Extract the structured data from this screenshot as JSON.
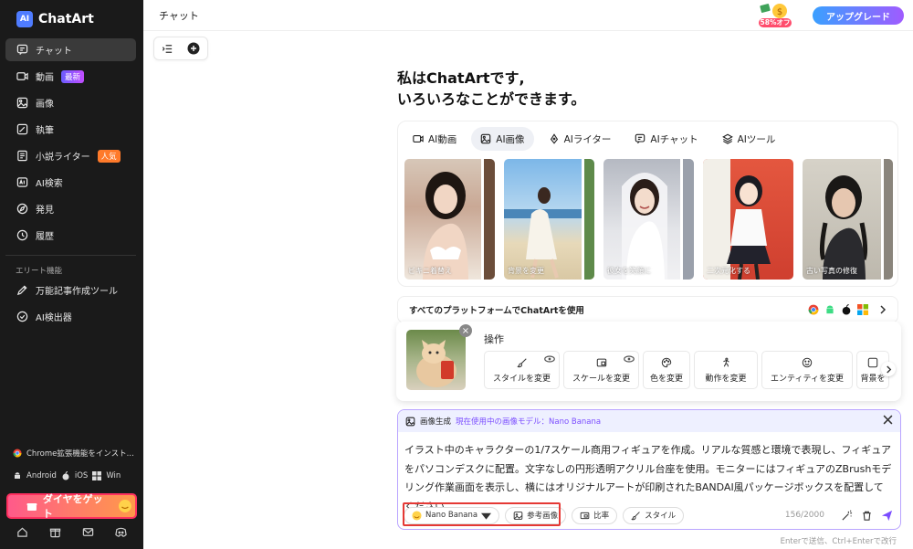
{
  "app": {
    "name": "ChatArt",
    "logo_mark": "AI"
  },
  "sidebar": {
    "items": [
      {
        "label": "チャット",
        "icon": "chat-icon",
        "active": true
      },
      {
        "label": "動画",
        "icon": "video-icon",
        "badge": "最新"
      },
      {
        "label": "画像",
        "icon": "image-icon"
      },
      {
        "label": "執筆",
        "icon": "pen-icon"
      },
      {
        "label": "小説ライター",
        "icon": "book-icon",
        "badge": "人気"
      },
      {
        "label": "AI検索",
        "icon": "ai-search-icon"
      },
      {
        "label": "発見",
        "icon": "compass-icon"
      },
      {
        "label": "履歴",
        "icon": "history-icon"
      }
    ],
    "section_label": "エリート機能",
    "elite_items": [
      {
        "label": "万能記事作成ツール",
        "icon": "edit-icon"
      },
      {
        "label": "AI検出器",
        "icon": "check-circle-icon"
      }
    ],
    "chrome_ext": "Chrome拡張機能をインスト...",
    "platforms": [
      "Android",
      "iOS",
      "Win"
    ],
    "diamond_button": "ダイヤをゲット"
  },
  "header": {
    "title": "チャット",
    "sale_badge": "58%オフ",
    "upgrade_label": "アップグレード"
  },
  "greeting": {
    "line1": "私はChatArtです,",
    "line2": "いろいろなことができます。"
  },
  "feature_tabs": [
    {
      "label": "AI動画",
      "icon": "video-icon"
    },
    {
      "label": "AI画像",
      "icon": "image-icon",
      "active": true
    },
    {
      "label": "AIライター",
      "icon": "pen-nib-icon"
    },
    {
      "label": "AIチャット",
      "icon": "chat-icon"
    },
    {
      "label": "AIツール",
      "icon": "layers-icon"
    }
  ],
  "thumbnails": [
    {
      "label": "ビキニ着替え"
    },
    {
      "label": "背景を変更"
    },
    {
      "label": "彼女を笑顔に"
    },
    {
      "label": "二次元化する"
    },
    {
      "label": "古い写真の修復"
    }
  ],
  "platform_bar": {
    "text": "すべてのプラットフォームでChatArtを使用"
  },
  "operations": {
    "title": "操作",
    "buttons": [
      {
        "label": "スタイルを変更",
        "icon": "brush-icon"
      },
      {
        "label": "スケールを変更",
        "icon": "scale-icon"
      },
      {
        "label": "色を変更",
        "icon": "palette-icon"
      },
      {
        "label": "動作を変更",
        "icon": "motion-icon"
      },
      {
        "label": "エンティティを変更",
        "icon": "smile-icon"
      },
      {
        "label": "背景を",
        "icon": "background-icon"
      }
    ]
  },
  "input_panel": {
    "mode_label": "画像生成",
    "model_label": "現在使用中の画像モデル：Nano Banana",
    "prompt": "イラスト中のキャラクターの1/7スケール商用フィギュアを作成。リアルな質感と環境で表現し、フィギュアをパソコンデスクに配置。文字なしの円形透明アクリル台座を使用。モニターにはフィギュアのZBrushモデリング作業画面を表示し、横にはオリジナルアートが印刷されたBANDAI風パッケージボックスを配置してください。",
    "model_pill": "Nano Banana",
    "reference_pill": "参考画像",
    "ratio_pill": "比率",
    "style_pill": "スタイル",
    "counter": "156/2000"
  },
  "hint": "Enterで送信、Ctrl+Enterで改行",
  "colors": {
    "accent": "#7b4dff",
    "highlight": "#e53935",
    "upgrade_start": "#3aa0ff",
    "upgrade_end": "#a05bff"
  }
}
